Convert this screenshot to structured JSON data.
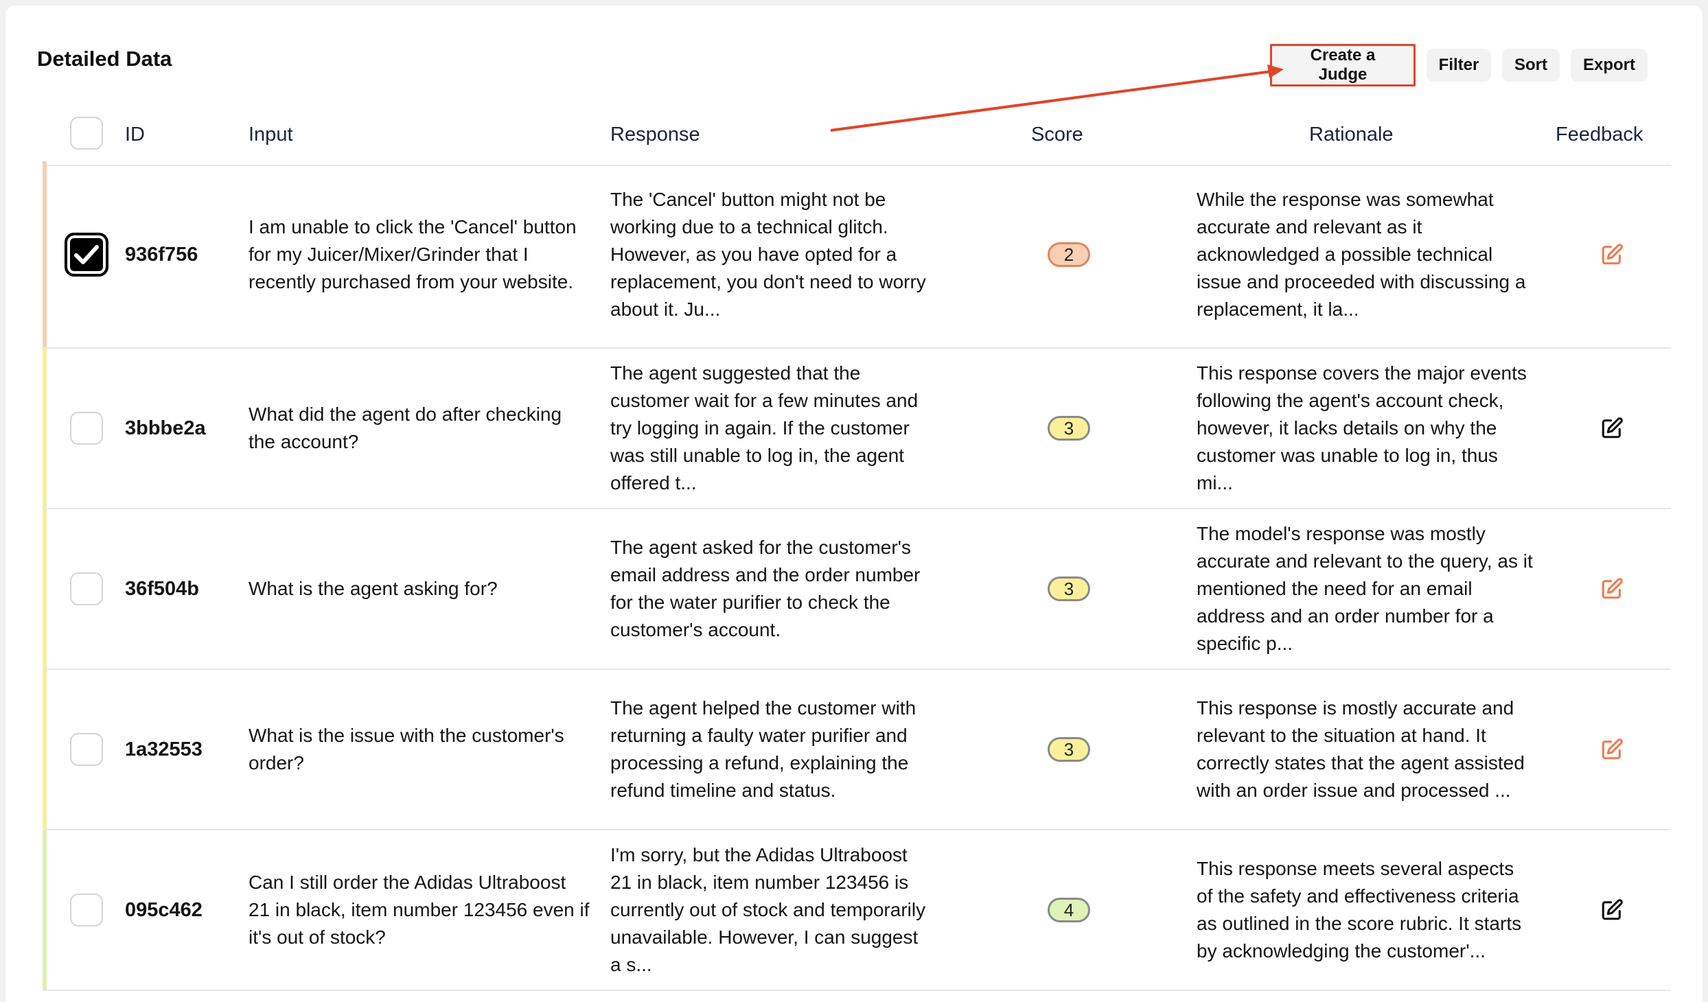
{
  "header": {
    "title": "Detailed Data"
  },
  "toolbar": {
    "create_judge_label": "Create a Judge",
    "filter_label": "Filter",
    "sort_label": "Sort",
    "export_label": "Export"
  },
  "table": {
    "columns": {
      "id": "ID",
      "input": "Input",
      "response": "Response",
      "score": "Score",
      "rationale": "Rationale",
      "feedback": "Feedback"
    },
    "rows": [
      {
        "id": "936f756",
        "checked": true,
        "input": "I am unable to click the 'Cancel' button for my Juicer/Mixer/Grinder that I recently purchased from your website.",
        "response": "The 'Cancel' button might not be working due to a technical glitch. However, as you have opted for a replacement, you don't need to worry about it. Ju...",
        "score": "2",
        "score_color": "#f8cfb4",
        "score_border": "#e0875a",
        "strip_color": "#f7cfae",
        "rationale": "While the response was somewhat accurate and relevant as it acknowledged a possible technical issue and proceeded with discussing a replacement, it la...",
        "feedback_icon_color": "#ef7b4e"
      },
      {
        "id": "3bbbe2a",
        "checked": false,
        "input": "What did the agent do after checking the account?",
        "response": "The agent suggested that the customer wait for a few minutes and try logging in again. If the customer was still unable to log in, the agent offered t...",
        "score": "3",
        "score_color": "#fbf09a",
        "score_border": "#8a8a8a",
        "strip_color": "#f5ef96",
        "rationale": "This response covers the major events following the agent's account check, however, it lacks details on why the customer was unable to log in, thus mi...",
        "feedback_icon_color": "#111111"
      },
      {
        "id": "36f504b",
        "checked": false,
        "input": "What is the agent asking for?",
        "response": "The agent asked for the customer's email address and the order number for the water purifier to check the customer's account.",
        "score": "3",
        "score_color": "#fbf09a",
        "score_border": "#8a8a8a",
        "strip_color": "#f5ef96",
        "rationale": "The model's response was mostly accurate and relevant to the query, as it mentioned the need for an email address and an order number for a specific p...",
        "feedback_icon_color": "#ef7b4e"
      },
      {
        "id": "1a32553",
        "checked": false,
        "input": "What is the issue with the customer's order?",
        "response": "The agent helped the customer with returning a faulty water purifier and processing a refund, explaining the refund timeline and status.",
        "score": "3",
        "score_color": "#fbf09a",
        "score_border": "#8a8a8a",
        "strip_color": "#f5ef96",
        "rationale": "This response is mostly accurate and relevant to the situation at hand. It correctly states that the agent assisted with an order issue and processed ...",
        "feedback_icon_color": "#ef7b4e"
      },
      {
        "id": "095c462",
        "checked": false,
        "input": "Can I still order the Adidas Ultraboost 21 in black, item number 123456 even if it's out of stock?",
        "response": "I'm sorry, but the Adidas Ultraboost 21 in black, item number 123456 is currently out of stock and temporarily unavailable. However, I can suggest a s...",
        "score": "4",
        "score_color": "#dff2b8",
        "score_border": "#8a8a8a",
        "strip_color": "#dcf2b0",
        "rationale": "This response meets several aspects of the safety and effectiveness criteria as outlined in the score rubric. It starts by acknowledging the customer'...",
        "feedback_icon_color": "#111111"
      }
    ]
  }
}
